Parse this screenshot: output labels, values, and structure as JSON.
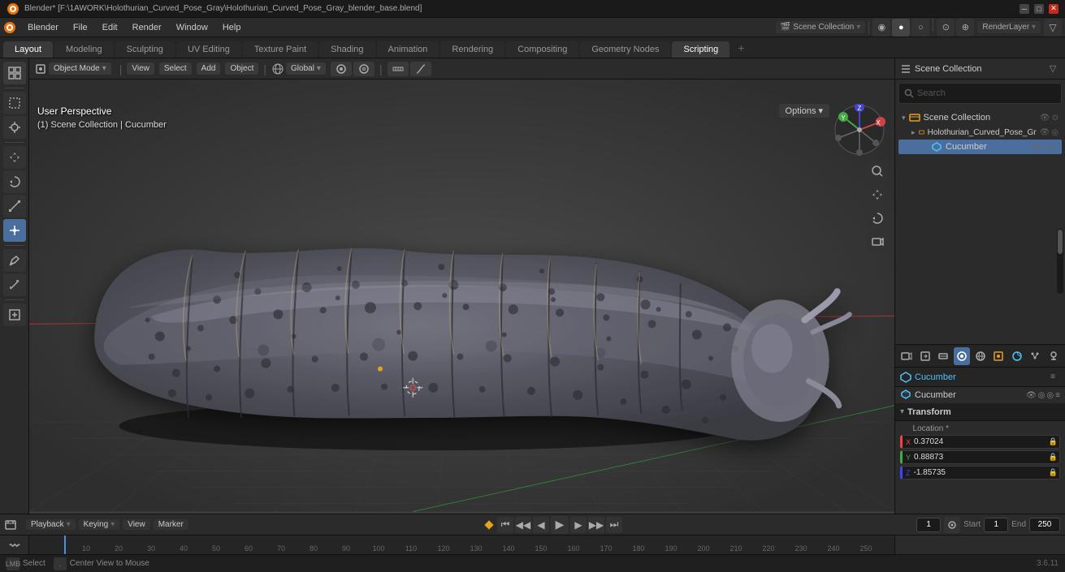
{
  "window": {
    "title": "Blender* [F:\\1AWORK\\Holothurian_Curved_Pose_Gray\\Holothurian_Curved_Pose_Gray_blender_base.blend]",
    "controls": [
      "minimize",
      "maximize",
      "close"
    ]
  },
  "menu": {
    "items": [
      "Blender",
      "File",
      "Edit",
      "Render",
      "Window",
      "Help"
    ]
  },
  "workspace_tabs": {
    "tabs": [
      "Layout",
      "Modeling",
      "Sculpting",
      "UV Editing",
      "Texture Paint",
      "Shading",
      "Animation",
      "Rendering",
      "Compositing",
      "Geometry Nodes",
      "Scripting"
    ],
    "active": "Layout",
    "add_label": "+"
  },
  "viewport": {
    "mode_label": "Object Mode",
    "transform_label": "Global",
    "info_line1": "User Perspective",
    "info_line2": "(1) Scene Collection | Cucumber",
    "options_label": "Options",
    "options_arrow": "▾"
  },
  "viewport_header": {
    "mode_btn": "Object Mode",
    "mode_arrow": "▾",
    "view_btn": "View",
    "select_btn": "Select",
    "add_btn": "Add",
    "object_btn": "Object",
    "transform_btn": "Global",
    "transform_arrow": "▾",
    "snap_btn": "⊙",
    "proportional_btn": "○"
  },
  "left_tools": {
    "tools": [
      {
        "name": "select-box",
        "icon": "⬚",
        "active": false
      },
      {
        "name": "cursor",
        "icon": "+",
        "active": false
      },
      {
        "name": "move",
        "icon": "✛",
        "active": false
      },
      {
        "name": "rotate",
        "icon": "↻",
        "active": false
      },
      {
        "name": "scale",
        "icon": "⤢",
        "active": false
      },
      {
        "name": "transform",
        "icon": "⊞",
        "active": true
      },
      {
        "name": "sep1",
        "type": "separator"
      },
      {
        "name": "annotate",
        "icon": "✏",
        "active": false
      },
      {
        "name": "measure",
        "icon": "📐",
        "active": false
      },
      {
        "name": "sep2",
        "type": "separator"
      },
      {
        "name": "add-cube",
        "icon": "⬜",
        "active": false
      }
    ]
  },
  "nav_gizmo": {
    "x_label": "X",
    "y_label": "Y",
    "z_label": "Z",
    "x_color": "#e44",
    "y_color": "#4a4",
    "z_color": "#44e",
    "dot_color": "#aaa"
  },
  "outliner": {
    "title": "Scene Collection",
    "search_placeholder": "Search",
    "items": [
      {
        "id": "scene-collection",
        "label": "Scene Collection",
        "icon": "🎬",
        "level": 0,
        "expanded": true,
        "type": "scene"
      },
      {
        "id": "holothurian",
        "label": "Holothurian_Curved_Pose_Gr",
        "icon": "▸",
        "level": 1,
        "type": "collection"
      },
      {
        "id": "cucumber",
        "label": "Cucumber",
        "icon": "🔺",
        "level": 2,
        "type": "mesh",
        "selected": true
      }
    ]
  },
  "properties_toolbar": {
    "icons": [
      "scene",
      "world",
      "object",
      "modifier",
      "particles",
      "physics",
      "constraints",
      "object-data",
      "material",
      "texture"
    ],
    "active": "object"
  },
  "properties": {
    "selected_object": "Cucumber",
    "object_name": "Cucumber",
    "section_transform": "Transform",
    "location": {
      "label": "Location *",
      "x_label": "X",
      "y_label": "Y",
      "z_label": "Z",
      "x_value": "0.37024",
      "y_value": "0.88873",
      "z_value": "-1.85735"
    }
  },
  "timeline": {
    "playback_label": "Playback",
    "playback_arrow": "▾",
    "keying_label": "Keying",
    "keying_arrow": "▾",
    "view_label": "View",
    "marker_label": "Marker",
    "frame_current": "1",
    "frame_start_label": "Start",
    "frame_start": "1",
    "frame_end_label": "End",
    "frame_end": "250",
    "play_btn": "▶",
    "skip_start_btn": "⏮",
    "prev_key_btn": "⏪",
    "prev_frame_btn": "◀",
    "next_frame_btn": "▶",
    "next_key_btn": "⏩",
    "skip_end_btn": "⏭",
    "frame_marks": [
      "",
      "10",
      "20",
      "30",
      "40",
      "50",
      "60",
      "70",
      "80",
      "90",
      "100",
      "110",
      "120",
      "130",
      "140",
      "150",
      "160",
      "170",
      "180",
      "190",
      "200",
      "210",
      "220",
      "230",
      "240",
      "250"
    ]
  },
  "status_bar": {
    "select_label": "Select",
    "center_label": "Center View to Mouse",
    "version": "3.6.11"
  },
  "colors": {
    "bg_dark": "#1a1a1a",
    "bg_mid": "#2b2b2b",
    "bg_light": "#3a3a3a",
    "accent_blue": "#4a6f9f",
    "accent_orange": "#e8a020",
    "x_axis": "#e44444",
    "y_axis": "#44aa44",
    "z_axis": "#4444ee",
    "viewport_bg": "#3d3d3d"
  }
}
